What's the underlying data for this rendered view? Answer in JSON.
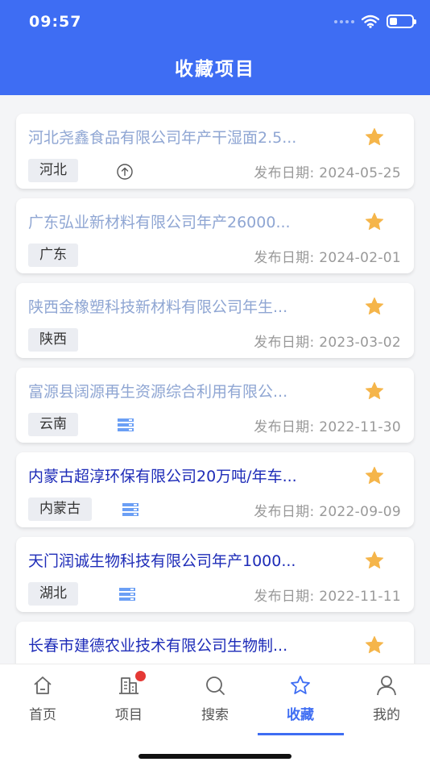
{
  "status_bar": {
    "time": "09:57"
  },
  "header": {
    "title": "收藏项目"
  },
  "projects": [
    {
      "title": "河北尧鑫食品有限公司年产干湿面2.5...",
      "region": "河北",
      "date": "发布日期: 2024-05-25",
      "icon": "upload-circle-icon",
      "read": true
    },
    {
      "title": "广东弘业新材料有限公司年产26000...",
      "region": "广东",
      "date": "发布日期: 2024-02-01",
      "icon": "",
      "read": true
    },
    {
      "title": "陕西金橡塑科技新材料有限公司年生...",
      "region": "陕西",
      "date": "发布日期: 2023-03-02",
      "icon": "",
      "read": true
    },
    {
      "title": "富源县阔源再生资源综合利用有限公...",
      "region": "云南",
      "date": "发布日期: 2022-11-30",
      "icon": "server-icon",
      "read": true
    },
    {
      "title": "内蒙古超淳环保有限公司20万吨/年车...",
      "region": "内蒙古",
      "date": "发布日期: 2022-09-09",
      "icon": "server-icon",
      "read": false
    },
    {
      "title": "天门润诚生物科技有限公司年产1000...",
      "region": "湖北",
      "date": "发布日期: 2022-11-11",
      "icon": "server-icon",
      "read": false
    },
    {
      "title": "长春市建德农业技术有限公司生物制...",
      "region": "",
      "date": "",
      "icon": "",
      "read": false
    }
  ],
  "tabbar": {
    "items": [
      {
        "label": "首页",
        "icon": "home-icon"
      },
      {
        "label": "项目",
        "icon": "building-icon"
      },
      {
        "label": "搜索",
        "icon": "search-icon"
      },
      {
        "label": "收藏",
        "icon": "star-icon"
      },
      {
        "label": "我的",
        "icon": "user-icon"
      }
    ],
    "active": 3
  },
  "colors": {
    "primary": "#3e6df3",
    "star": "#f5b54a",
    "read_title": "#8fa6d3",
    "unread_title": "#1e2cb8",
    "badge": "#e53935"
  }
}
